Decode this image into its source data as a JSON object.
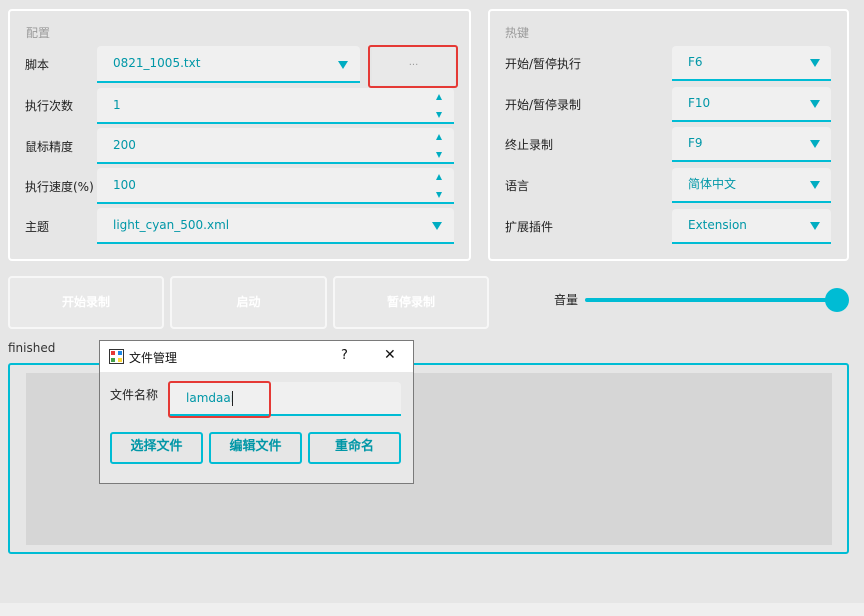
{
  "config": {
    "title": "配置",
    "script_label": "脚本",
    "script_value": "0821_1005.txt",
    "browse_label": "...",
    "run_count_label": "执行次数",
    "run_count_value": "1",
    "mouse_precision_label": "鼠标精度",
    "mouse_precision_value": "200",
    "run_speed_label": "执行速度(%)",
    "run_speed_value": "100",
    "theme_label": "主题",
    "theme_value": "light_cyan_500.xml"
  },
  "hotkeys": {
    "title": "热键",
    "rows": [
      {
        "label": "开始/暂停执行",
        "value": "F6"
      },
      {
        "label": "开始/暂停录制",
        "value": "F10"
      },
      {
        "label": "终止录制",
        "value": "F9"
      },
      {
        "label": "语言",
        "value": "简体中文"
      },
      {
        "label": "扩展插件",
        "value": "Extension"
      }
    ]
  },
  "actions": {
    "start_record": "开始录制",
    "launch": "启动",
    "pause_record": "暂停录制"
  },
  "volume": {
    "label": "音量",
    "level_percent": 100
  },
  "status": {
    "text": "finished"
  },
  "dialog": {
    "title": "文件管理",
    "help_glyph": "?",
    "close_glyph": "✕",
    "filename_label": "文件名称",
    "filename_value": "lamdaai",
    "select_file": "选择文件",
    "edit_file": "编辑文件",
    "rename": "重命名"
  },
  "colors": {
    "accent": "#00bcd4",
    "accent_text": "#0097a7",
    "highlight": "#e53935",
    "background": "#e6e6e6"
  }
}
